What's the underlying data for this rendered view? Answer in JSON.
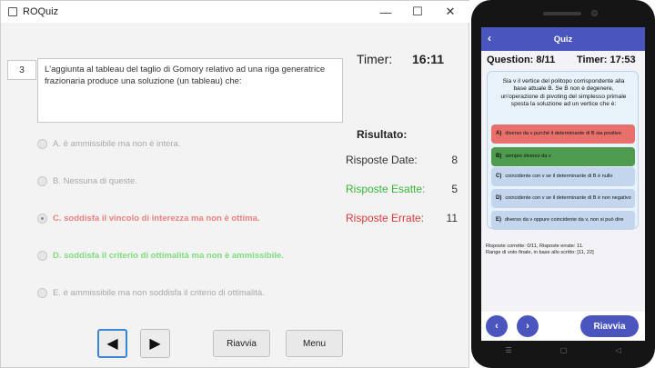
{
  "window": {
    "title": "ROQuiz",
    "minimize": "—",
    "maximize": "☐",
    "close": "✕"
  },
  "question": {
    "number": "3",
    "text": "L'aggiunta al tableau del taglio di Gomory relativo ad una riga generatrice frazionaria produce una soluzione (un tableau) che:"
  },
  "options": [
    {
      "label": "A. è ammissibile ma non è intera.",
      "color": "#a9a9a9",
      "checked": false
    },
    {
      "label": "B. Nessuna di queste.",
      "color": "#a9a9a9",
      "checked": false
    },
    {
      "label": "C. soddisfa il vincolo di interezza ma non è ottima.",
      "color": "#ef7f7f",
      "checked": true
    },
    {
      "label": "D. soddisfa il criterio di ottimalità ma non è ammissibile.",
      "color": "#7ddc7d",
      "checked": false
    },
    {
      "label": "E. è ammissibile ma non soddisfa il criterio di ottimalità.",
      "color": "#a9a9a9",
      "checked": false
    }
  ],
  "timer": {
    "label": "Timer:",
    "value": "16:11"
  },
  "result": {
    "title": "Risultato:",
    "given": {
      "label": "Risposte Date:",
      "value": "8",
      "color": "#333333"
    },
    "correct": {
      "label": "Risposte Esatte:",
      "value": "5",
      "color": "#3ab53a"
    },
    "wrong": {
      "label": "Risposte Errate:",
      "value": "11",
      "color": "#dd3b3b"
    }
  },
  "buttons": {
    "prev_icon": "◀",
    "next_icon": "▶",
    "restart": "Riavvia",
    "menu": "Menu"
  },
  "mobile": {
    "appbar_title": "Quiz",
    "back_icon": "‹",
    "question_counter": "Question: 8/11",
    "timer": "Timer: 17:53",
    "question_text": "Sia v il vertice del politopo corrispondente alla base attuale B. Se B non è degenere, un'operazione di pivoting del simplesso primale sposta la soluzione ad un vertice che è:",
    "options": [
      {
        "letter": "A)",
        "text": "diverso da v purchè il determinante di B sia positivo",
        "bg": "#e8706c"
      },
      {
        "letter": "B)",
        "text": "sempre diverso da v",
        "bg": "#4e9a4e"
      },
      {
        "letter": "C)",
        "text": "coincidente con v se il determinante di B è nullo",
        "bg": "#c4d6ee"
      },
      {
        "letter": "D)",
        "text": "coincidente con v se il determinante di B è non negativo",
        "bg": "#c4d6ee"
      },
      {
        "letter": "E)",
        "text": "diverso da v oppure coincidente da v, non si può dire",
        "bg": "#c4d6ee"
      }
    ],
    "summary_line1": "Risposte corrette: 0/11, Risposte errate: 11.",
    "summary_line2": "Range di voto finale, in base allo scritto: [11, 22]",
    "prev_icon": "‹",
    "next_icon": "›",
    "restart": "Riavvia",
    "nav_bar": {
      "recents": "☰",
      "home": "▢",
      "back": "◁"
    }
  },
  "colors": {
    "accent": "#4b55be",
    "focus": "#3a86d4"
  }
}
